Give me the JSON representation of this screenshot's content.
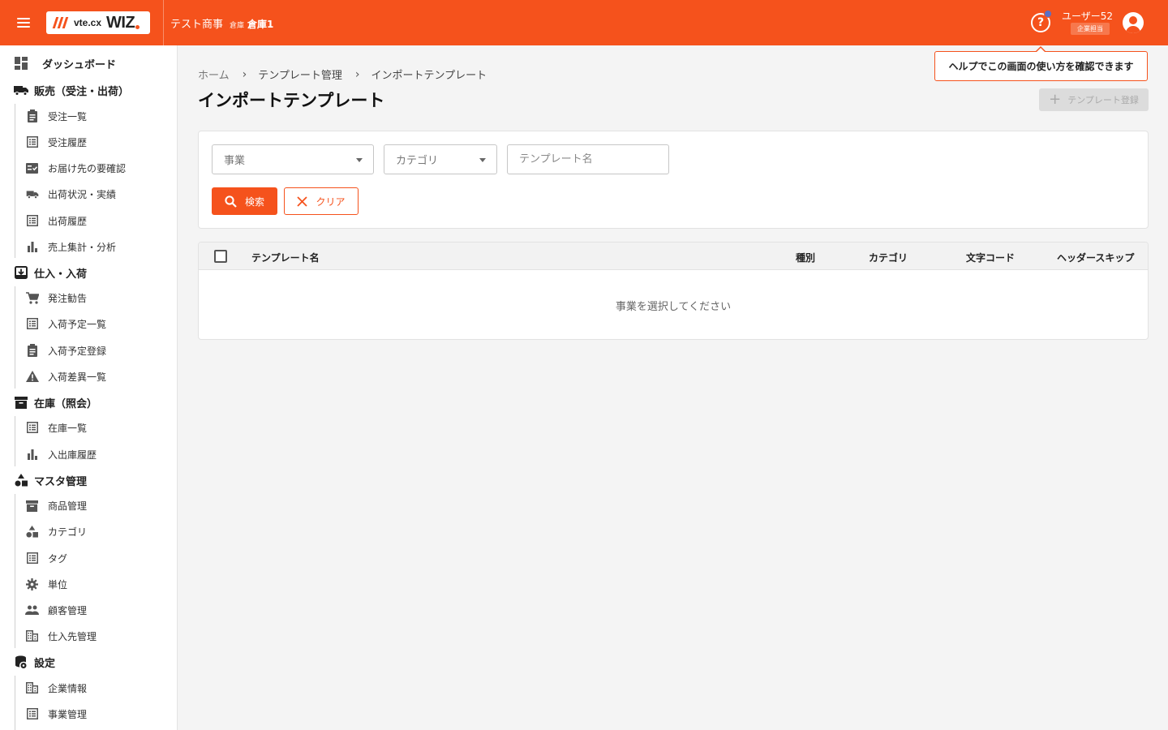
{
  "header": {
    "logo_text": "vte.cx",
    "logo_brand": "WIZ",
    "company": "テスト商事",
    "warehouse_label": "倉庫",
    "warehouse_name": "倉庫1",
    "help_icon": "help-circle-icon",
    "user_name": "ユーザー52",
    "user_role": "企業担当",
    "accent_color": "#f5521c"
  },
  "tooltip": {
    "text": "ヘルプでこの画面の使い方を確認できます"
  },
  "sidebar": {
    "dashboard": "ダッシュボード",
    "sections": [
      {
        "label": "販売（受注・出荷）",
        "icon": "truck-icon",
        "items": [
          {
            "label": "受注一覧",
            "icon": "clipboard-icon"
          },
          {
            "label": "受注履歴",
            "icon": "list-icon"
          },
          {
            "label": "お届け先の要確認",
            "icon": "checklist-icon"
          },
          {
            "label": "出荷状況・実績",
            "icon": "truck-icon"
          },
          {
            "label": "出荷履歴",
            "icon": "list-icon"
          },
          {
            "label": "売上集計・分析",
            "icon": "bar-chart-icon"
          }
        ]
      },
      {
        "label": "仕入・入荷",
        "icon": "inbox-icon",
        "items": [
          {
            "label": "発注勧告",
            "icon": "cart-icon"
          },
          {
            "label": "入荷予定一覧",
            "icon": "list-icon"
          },
          {
            "label": "入荷予定登録",
            "icon": "clipboard-icon"
          },
          {
            "label": "入荷差異一覧",
            "icon": "warning-icon"
          }
        ]
      },
      {
        "label": "在庫（照会）",
        "icon": "archive-icon",
        "items": [
          {
            "label": "在庫一覧",
            "icon": "list-icon"
          },
          {
            "label": "入出庫履歴",
            "icon": "bar-chart-icon"
          }
        ]
      },
      {
        "label": "マスタ管理",
        "icon": "shapes-icon",
        "items": [
          {
            "label": "商品管理",
            "icon": "archive-icon"
          },
          {
            "label": "カテゴリ",
            "icon": "shapes-icon"
          },
          {
            "label": "タグ",
            "icon": "list-icon"
          },
          {
            "label": "単位",
            "icon": "gear-icon"
          },
          {
            "label": "顧客管理",
            "icon": "people-icon"
          },
          {
            "label": "仕入先管理",
            "icon": "building-icon"
          }
        ]
      },
      {
        "label": "設定",
        "icon": "settings-db-icon",
        "items": [
          {
            "label": "企業情報",
            "icon": "building-icon"
          },
          {
            "label": "事業管理",
            "icon": "list-icon"
          }
        ]
      }
    ]
  },
  "breadcrumb": [
    "ホーム",
    "テンプレート管理",
    "インポートテンプレート"
  ],
  "page": {
    "title": "インポートテンプレート",
    "add_button": "テンプレート登録"
  },
  "search": {
    "business_placeholder": "事業",
    "category_placeholder": "カテゴリ",
    "name_placeholder": "テンプレート名",
    "search_button": "検索",
    "clear_button": "クリア"
  },
  "table": {
    "columns": [
      "テンプレート名",
      "種別",
      "カテゴリ",
      "文字コード",
      "ヘッダースキップ"
    ],
    "empty_message": "事業を選択してください"
  }
}
